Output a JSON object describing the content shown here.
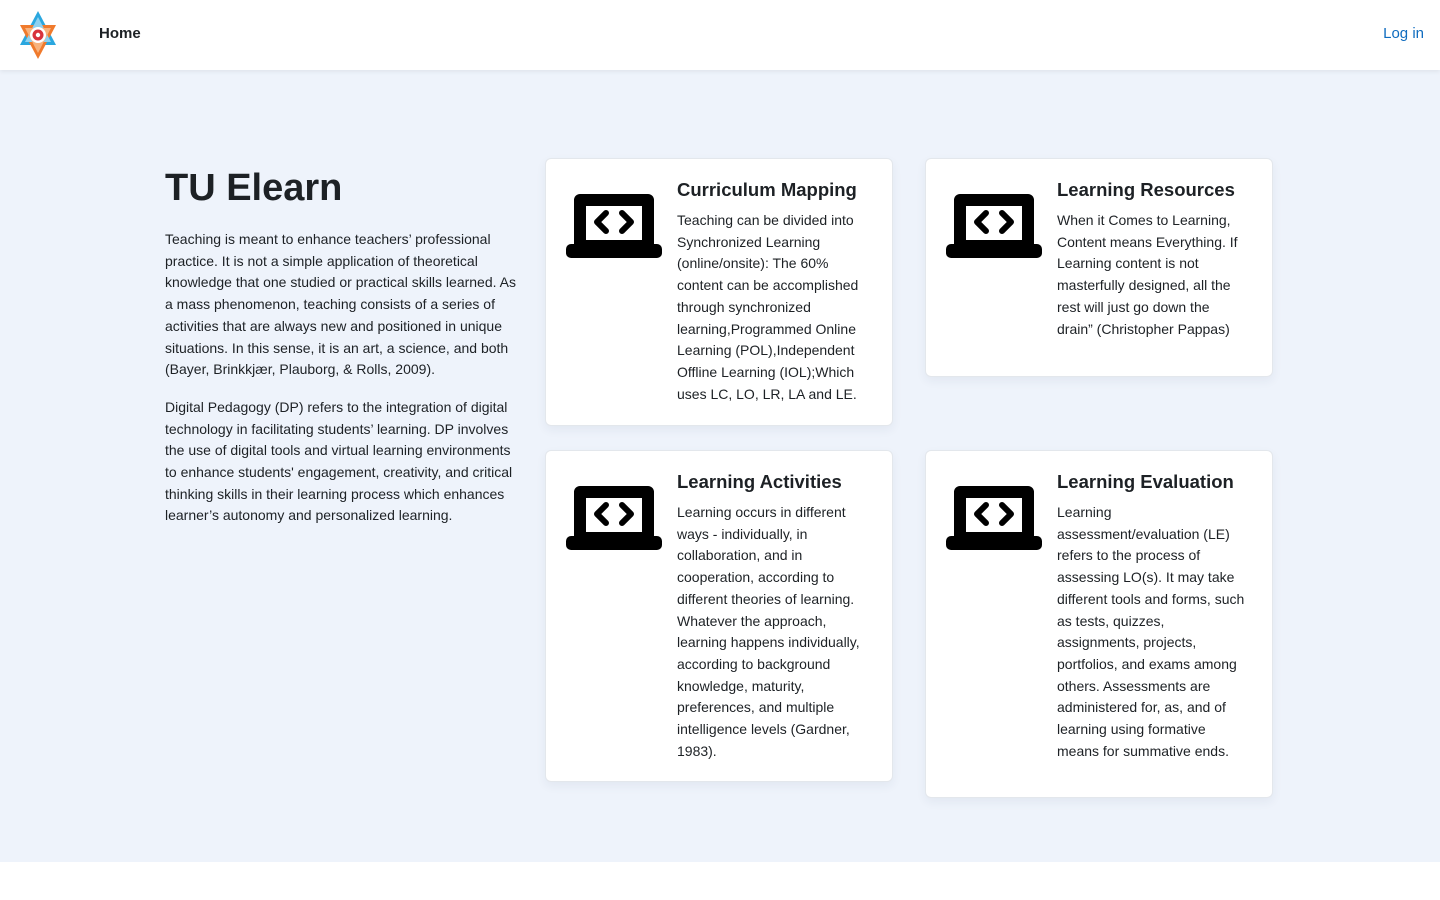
{
  "navbar": {
    "home_label": "Home",
    "login_label": "Log in",
    "logo_icon": "tu-star-logo-icon"
  },
  "intro": {
    "title": "TU Elearn",
    "paragraph1": "Teaching is meant to enhance teachers’ professional practice. It is not a simple application of theoretical knowledge that one studied or practical skills learned. As a mass phenomenon, teaching consists of a series of activities that are always new and positioned in unique situations. In this sense, it is an art, a science,  and both (Bayer, Brinkkjær, Plauborg, & Rolls, 2009).",
    "paragraph2": "Digital Pedagogy (DP) refers to the integration of digital technology in facilitating students’ learning. DP involves the use of digital tools and virtual learning environments to enhance students' engagement, creativity, and critical thinking skills in their learning process which enhances learner’s autonomy and personalized learning."
  },
  "cards": [
    {
      "icon": "laptop-code-icon",
      "title": "Curriculum Mapping",
      "text": "Teaching can be divided into Synchronized Learning (online/onsite): The 60% content can be accomplished through synchronized learning,Programmed Online Learning (POL),Independent Offline Learning (IOL);Which uses LC, LO, LR, LA and LE."
    },
    {
      "icon": "laptop-code-icon",
      "title": "Learning Resources",
      "text": "When it Comes to Learning, Content means Everything. If Learning content is not masterfully designed, all the rest will just go down the drain” (Christopher Pappas)"
    },
    {
      "icon": "laptop-code-icon",
      "title": "Learning Activities",
      "text": "Learning occurs in different ways - individually, in collaboration, and in cooperation, according to different theories of learning. Whatever the approach, learning happens individually, according to background knowledge, maturity, preferences, and multiple intelligence levels (Gardner, 1983)."
    },
    {
      "icon": "laptop-code-icon",
      "title": "Learning Evaluation",
      "text": "Learning assessment/evaluation (LE) refers to the process of assessing LO(s). It may take different tools and forms, such as tests, quizzes, assignments, projects, portfolios, and exams among others. Assessments are administered for, as, and of learning using formative means for summative ends."
    }
  ],
  "colors": {
    "accent": "#0f6cbf",
    "page_background": "#eef3fb",
    "text": "#1d2125"
  }
}
